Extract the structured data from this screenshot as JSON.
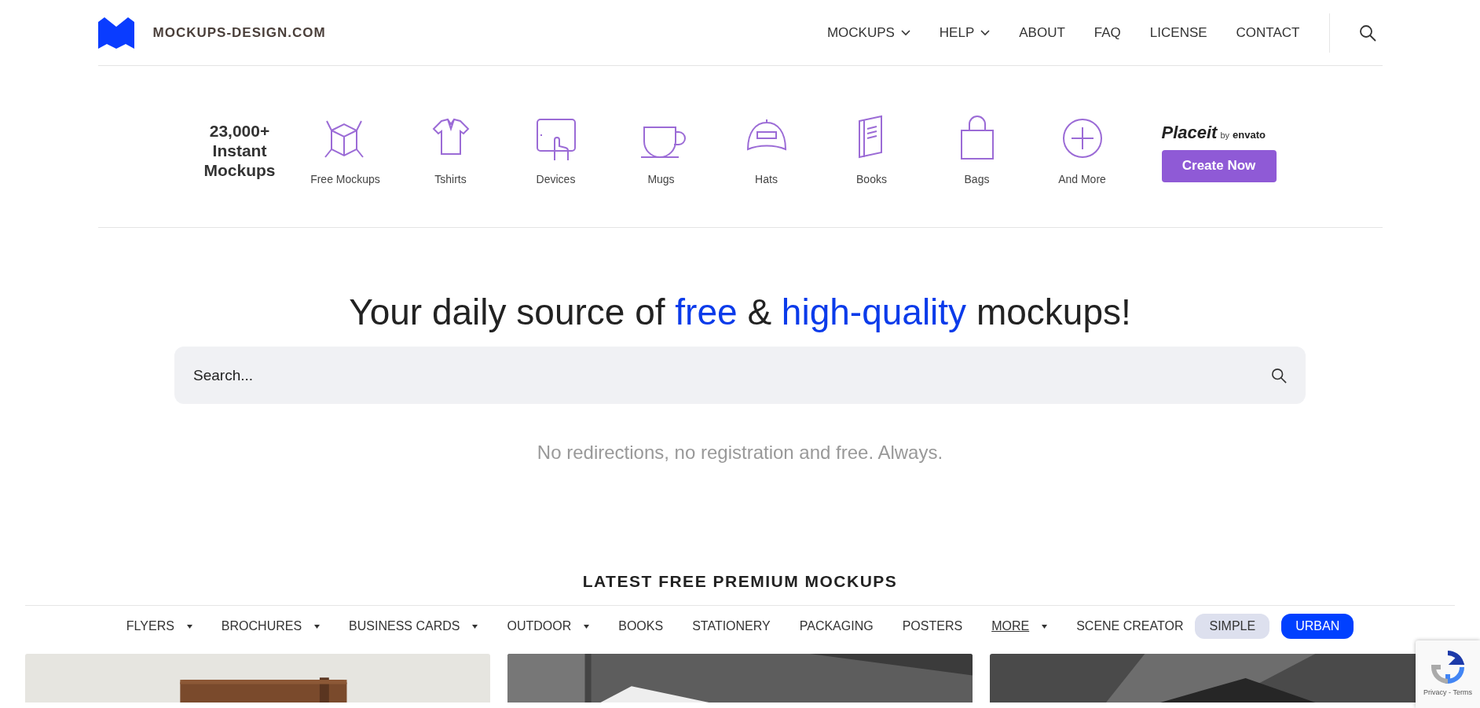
{
  "brand": "MOCKUPS-DESIGN.COM",
  "nav": [
    {
      "label": "MOCKUPS",
      "has_menu": true
    },
    {
      "label": "HELP",
      "has_menu": true
    },
    {
      "label": "ABOUT",
      "has_menu": false
    },
    {
      "label": "FAQ",
      "has_menu": false
    },
    {
      "label": "LICENSE",
      "has_menu": false
    },
    {
      "label": "CONTACT",
      "has_menu": false
    }
  ],
  "banner": {
    "count": "23,000+",
    "count_caption": "Instant Mockups",
    "categories": [
      "Free Mockups",
      "Tshirts",
      "Devices",
      "Mugs",
      "Hats",
      "Books",
      "Bags",
      "And More"
    ],
    "partner": {
      "name": "Placeit",
      "by": "by",
      "vendor": "envato",
      "button": "Create Now"
    }
  },
  "headline": [
    {
      "text": "Your daily source of ",
      "accent": false
    },
    {
      "text": "free",
      "accent": true
    },
    {
      "text": " & ",
      "accent": false
    },
    {
      "text": "high-quality",
      "accent": true
    },
    {
      "text": " mockups!",
      "accent": false
    }
  ],
  "search": {
    "placeholder": "Search..."
  },
  "tagline": "No redirections, no registration and free. Always.",
  "section_title": "LATEST FREE PREMIUM MOCKUPS",
  "filters": [
    {
      "label": "FLYERS",
      "kind": "menu",
      "underlined": false
    },
    {
      "label": "BROCHURES",
      "kind": "menu",
      "underlined": false
    },
    {
      "label": "BUSINESS CARDS",
      "kind": "menu",
      "underlined": false
    },
    {
      "label": "OUTDOOR",
      "kind": "menu",
      "underlined": false
    },
    {
      "label": "BOOKS",
      "kind": "link",
      "underlined": false
    },
    {
      "label": "STATIONERY",
      "kind": "link",
      "underlined": false
    },
    {
      "label": "PACKAGING",
      "kind": "link",
      "underlined": false
    },
    {
      "label": "POSTERS",
      "kind": "link",
      "underlined": false
    },
    {
      "label": "MORE",
      "kind": "menu",
      "underlined": true
    },
    {
      "label": "SCENE CREATOR",
      "kind": "link",
      "underlined": false
    },
    {
      "label": "SIMPLE",
      "kind": "pill",
      "selected": false
    },
    {
      "label": "URBAN",
      "kind": "pill",
      "selected": true
    }
  ],
  "captcha": {
    "links": "Privacy - Terms"
  }
}
